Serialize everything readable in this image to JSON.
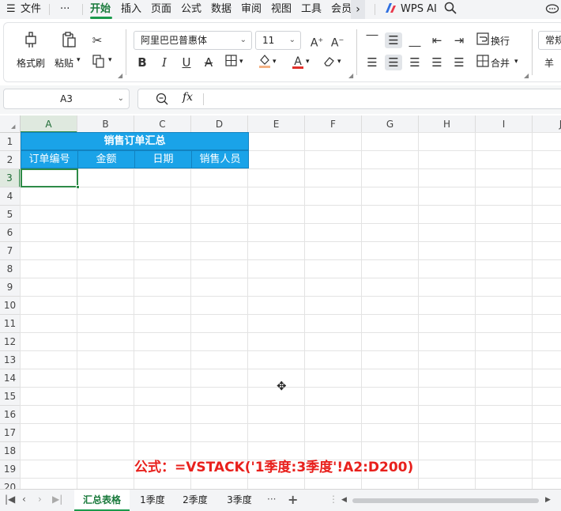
{
  "menu": {
    "hamburger": "☰",
    "file": "文件",
    "more": "···",
    "tabs": [
      "开始",
      "插入",
      "页面",
      "公式",
      "数据",
      "审阅",
      "视图",
      "工具",
      "会员"
    ],
    "more_arrow": "›",
    "wps_ai": "WPS AI",
    "search_icon": "search-icon",
    "cloud_icon": "cloud-icon"
  },
  "ribbon": {
    "format_painter": "格式刷",
    "paste": "粘贴",
    "font_name": "阿里巴巴普惠体",
    "font_size": "11",
    "wrap_text": "换行",
    "merge": "合并",
    "number_format": "常规",
    "currency": "羊"
  },
  "formula_bar": {
    "cell_ref": "A3",
    "fx": "fx",
    "zoom_icon": "zoom-icon",
    "formula": ""
  },
  "sheet": {
    "columns": [
      "A",
      "B",
      "C",
      "D",
      "E",
      "F",
      "G",
      "H",
      "I",
      "J"
    ],
    "rows": [
      "1",
      "2",
      "3",
      "4",
      "5",
      "6",
      "7",
      "8",
      "9",
      "10",
      "11",
      "12",
      "13",
      "14",
      "15",
      "16",
      "17",
      "18",
      "19",
      "20"
    ],
    "title": "销售订单汇总",
    "headers": [
      "订单编号",
      "金额",
      "日期",
      "销售人员"
    ],
    "active_cell": "A3",
    "note": "公式：=VSTACK('1季度:3季度'!A2:D200)"
  },
  "tabs": {
    "sheets": [
      "汇总表格",
      "1季度",
      "2季度",
      "3季度"
    ],
    "active": "汇总表格",
    "more": "···",
    "add": "+"
  },
  "colors": {
    "accent": "#1a9a4c",
    "header_fill": "#1aa3e8",
    "note_red": "#e8201c"
  }
}
